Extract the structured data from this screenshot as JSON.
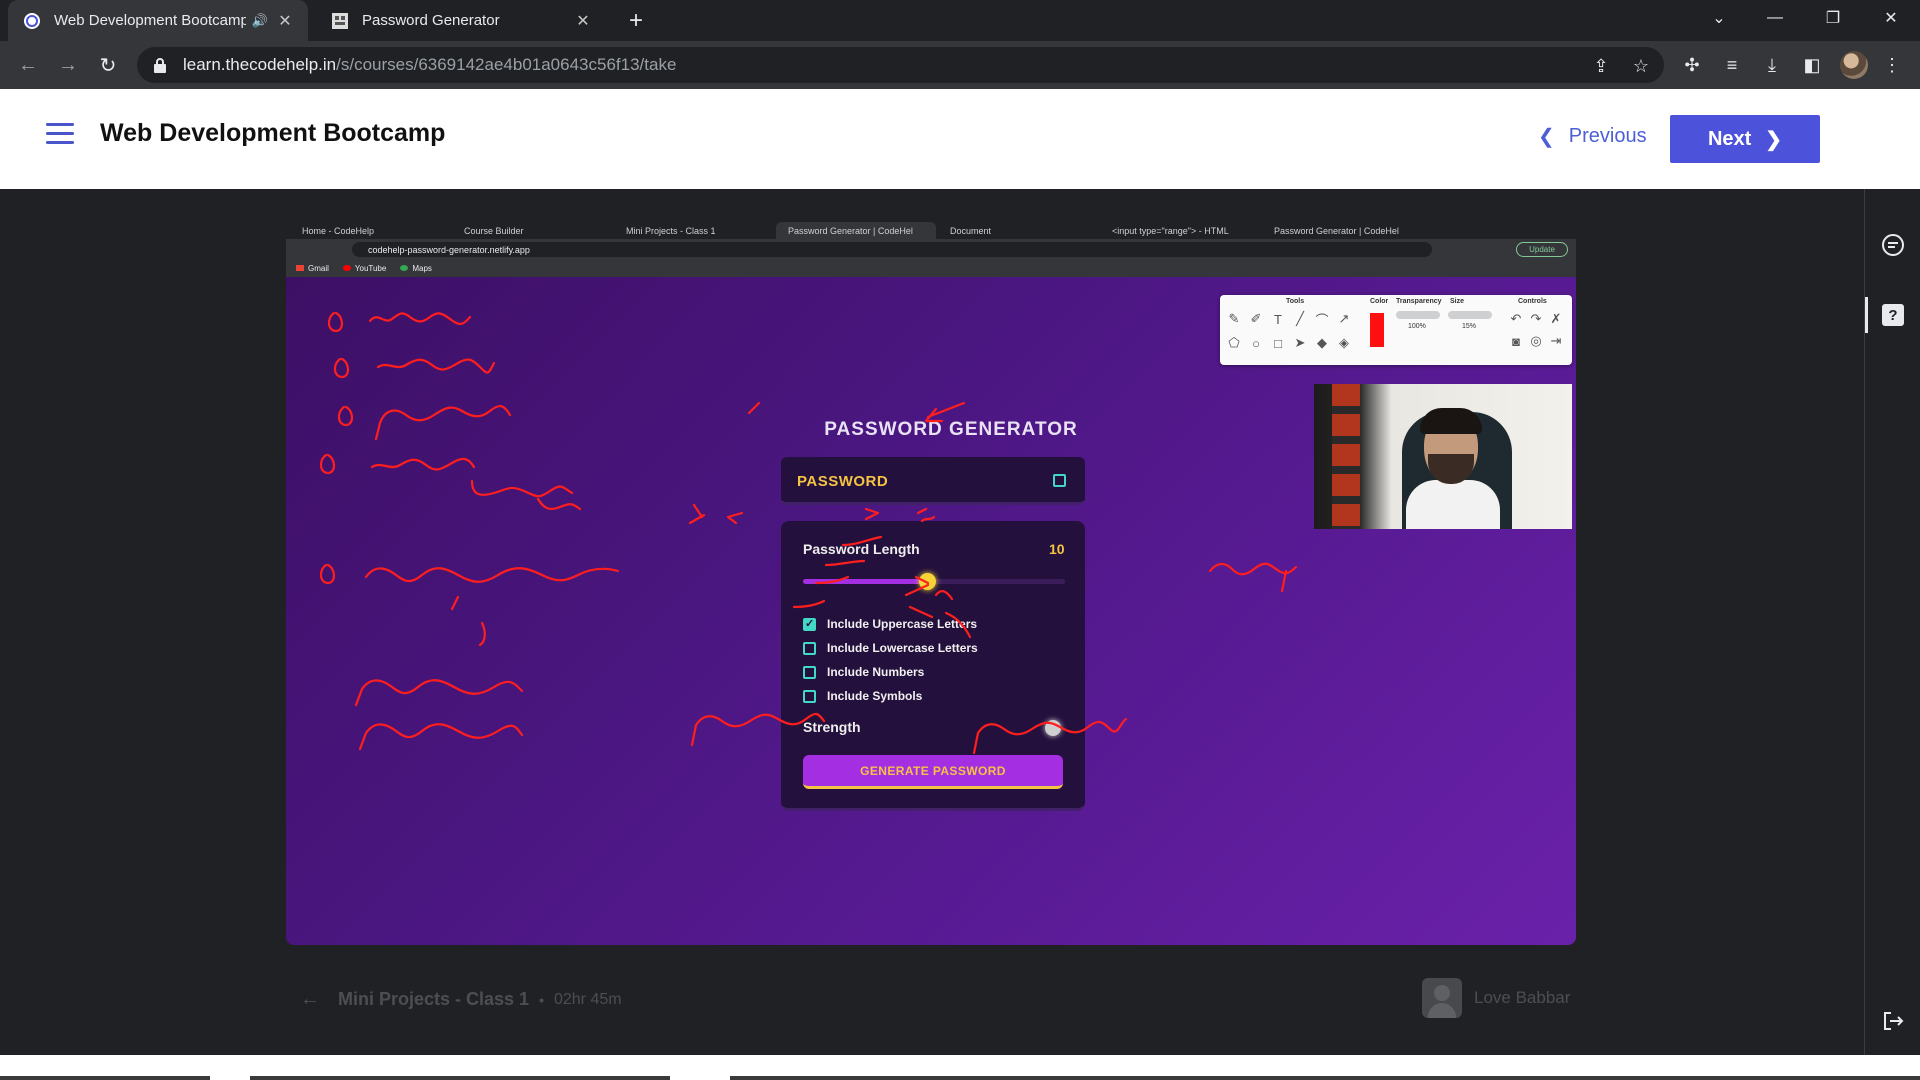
{
  "browser": {
    "tabs": [
      {
        "title": "Web Development Bootcamp",
        "active": true,
        "audio": true
      },
      {
        "title": "Password Generator",
        "active": false
      }
    ],
    "url": {
      "host": "learn.thecodehelp.in",
      "path": "/s/courses/6369142ae4b01a0643c56f13/take"
    }
  },
  "header": {
    "course_title": "Web Development Bootcamp",
    "previous_label": "Previous",
    "next_label": "Next"
  },
  "video": {
    "inner_browser": {
      "tabs": [
        "Home - CodeHelp",
        "Course Builder",
        "Mini Projects - Class 1",
        "Password Generator | CodeHel",
        "Document",
        "<input type=\"range\"> - HTML",
        "Password Generator | CodeHel"
      ],
      "url": "codehelp-password-generator.netlify.app",
      "update_label": "Update",
      "bookmarks": [
        "Gmail",
        "YouTube",
        "Maps"
      ]
    },
    "drawing_toolbar": {
      "headers": [
        "Tools",
        "Color",
        "Transparency",
        "Size",
        "Controls"
      ],
      "transparency": "100%",
      "size": "15%",
      "color": "#ff1010"
    },
    "app": {
      "title": "PASSWORD GENERATOR",
      "password_placeholder": "PASSWORD",
      "length_label": "Password Length",
      "length_value": "10",
      "slider_min": 1,
      "slider_max": 20,
      "slider_value": 10,
      "options": [
        {
          "label": "Include Uppercase Letters",
          "checked": true
        },
        {
          "label": "Include Lowercase Letters",
          "checked": false
        },
        {
          "label": "Include Numbers",
          "checked": false
        },
        {
          "label": "Include Symbols",
          "checked": false
        }
      ],
      "strength_label": "Strength",
      "generate_label": "GENERATE PASSWORD"
    }
  },
  "lesson": {
    "title": "Mini Projects - Class 1",
    "separator": "•",
    "duration": "02hr 45m",
    "instructor": "Love Babbar"
  },
  "colors": {
    "accent": "#4c52da",
    "link": "#4c5fd5",
    "annotation": "#ff1e1e"
  }
}
